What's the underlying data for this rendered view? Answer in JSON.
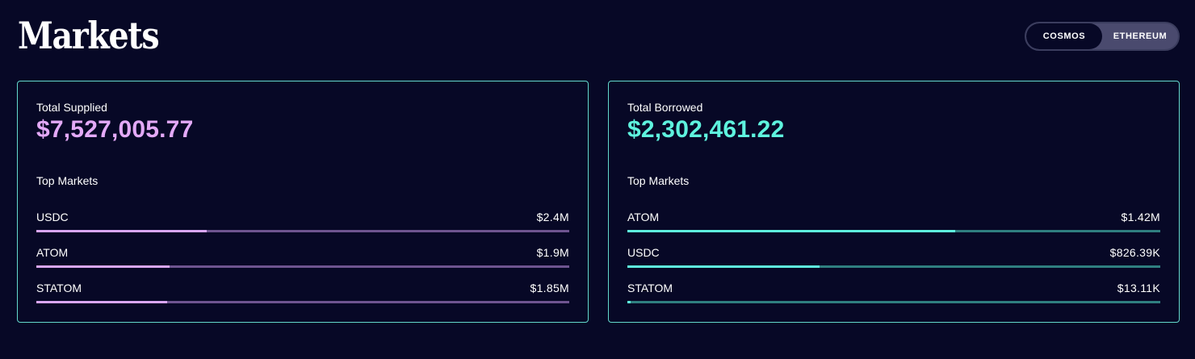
{
  "header": {
    "title": "Markets",
    "network_toggle": {
      "options": [
        "COSMOS",
        "ETHEREUM"
      ],
      "selected": "COSMOS"
    }
  },
  "supplied": {
    "label": "Total Supplied",
    "total": "$7,527,005.77",
    "top_label": "Top Markets",
    "accent_color": "#e3a9f7",
    "markets": [
      {
        "name": "USDC",
        "value": "$2.4M",
        "fill_fraction": 0.32
      },
      {
        "name": "ATOM",
        "value": "$1.9M",
        "fill_fraction": 0.25
      },
      {
        "name": "STATOM",
        "value": "$1.85M",
        "fill_fraction": 0.245
      }
    ]
  },
  "borrowed": {
    "label": "Total Borrowed",
    "total": "$2,302,461.22",
    "top_label": "Top Markets",
    "accent_color": "#5ef3de",
    "markets": [
      {
        "name": "ATOM",
        "value": "$1.42M",
        "fill_fraction": 0.615
      },
      {
        "name": "USDC",
        "value": "$826.39K",
        "fill_fraction": 0.36
      },
      {
        "name": "STATOM",
        "value": "$13.11K",
        "fill_fraction": 0.006
      }
    ]
  }
}
